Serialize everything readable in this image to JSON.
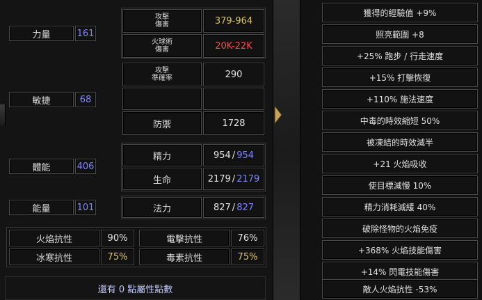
{
  "attributes": {
    "strength": {
      "label": "力量",
      "value": "161"
    },
    "dexterity": {
      "label": "敏捷",
      "value": "68"
    },
    "vitality": {
      "label": "體能",
      "value": "406"
    },
    "energy": {
      "label": "能量",
      "value": "101"
    }
  },
  "combat": {
    "attack_damage_label": "攻擊\n傷害",
    "attack_damage_value": "379-964",
    "fire_damage_label": "火球術\n傷害",
    "fire_damage_value": "20K-22K",
    "attack_rating_label": "攻擊\n準確率",
    "attack_rating_value": "290",
    "defense_label": "防禦",
    "defense_value": "1728"
  },
  "pools": {
    "stamina": {
      "label": "精力",
      "current": "954",
      "sep": "/",
      "max": "954"
    },
    "life": {
      "label": "生命",
      "current": "2179",
      "sep": "/",
      "max": "2179"
    },
    "mana": {
      "label": "法力",
      "current": "827",
      "sep": "/",
      "max": "827"
    }
  },
  "resistances": {
    "fire": {
      "label": "火焰抗性",
      "value": "90%"
    },
    "lightning": {
      "label": "電擊抗性",
      "value": "76%"
    },
    "cold": {
      "label": "冰寒抗性",
      "value": "75%"
    },
    "poison": {
      "label": "毒素抗性",
      "value": "75%"
    }
  },
  "footer": {
    "remaining_points": "還有 0 點屬性點數"
  },
  "bonuses": [
    "獲得的經驗值 +9%",
    "照亮範圍 +8",
    "+25% 跑步 / 行走速度",
    "+15% 打擊恢復",
    "+110% 施法速度",
    "中毒的時效縮短 50%",
    "被凍結的時效減半",
    "+21 火焰吸收",
    "使目標減慢 10%",
    "精力消耗減緩 40%",
    "破除怪物的火焰免疫",
    "+368% 火焰技能傷害",
    "+14% 閃電技能傷害",
    "敵人火焰抗性 -53%"
  ],
  "colors": {
    "blue_value": "#7f86ff",
    "yellow_value": "#d9c26a",
    "red_value": "#ff4a4a"
  },
  "icons": {
    "expand_arrow": "right-chevron-icon"
  }
}
